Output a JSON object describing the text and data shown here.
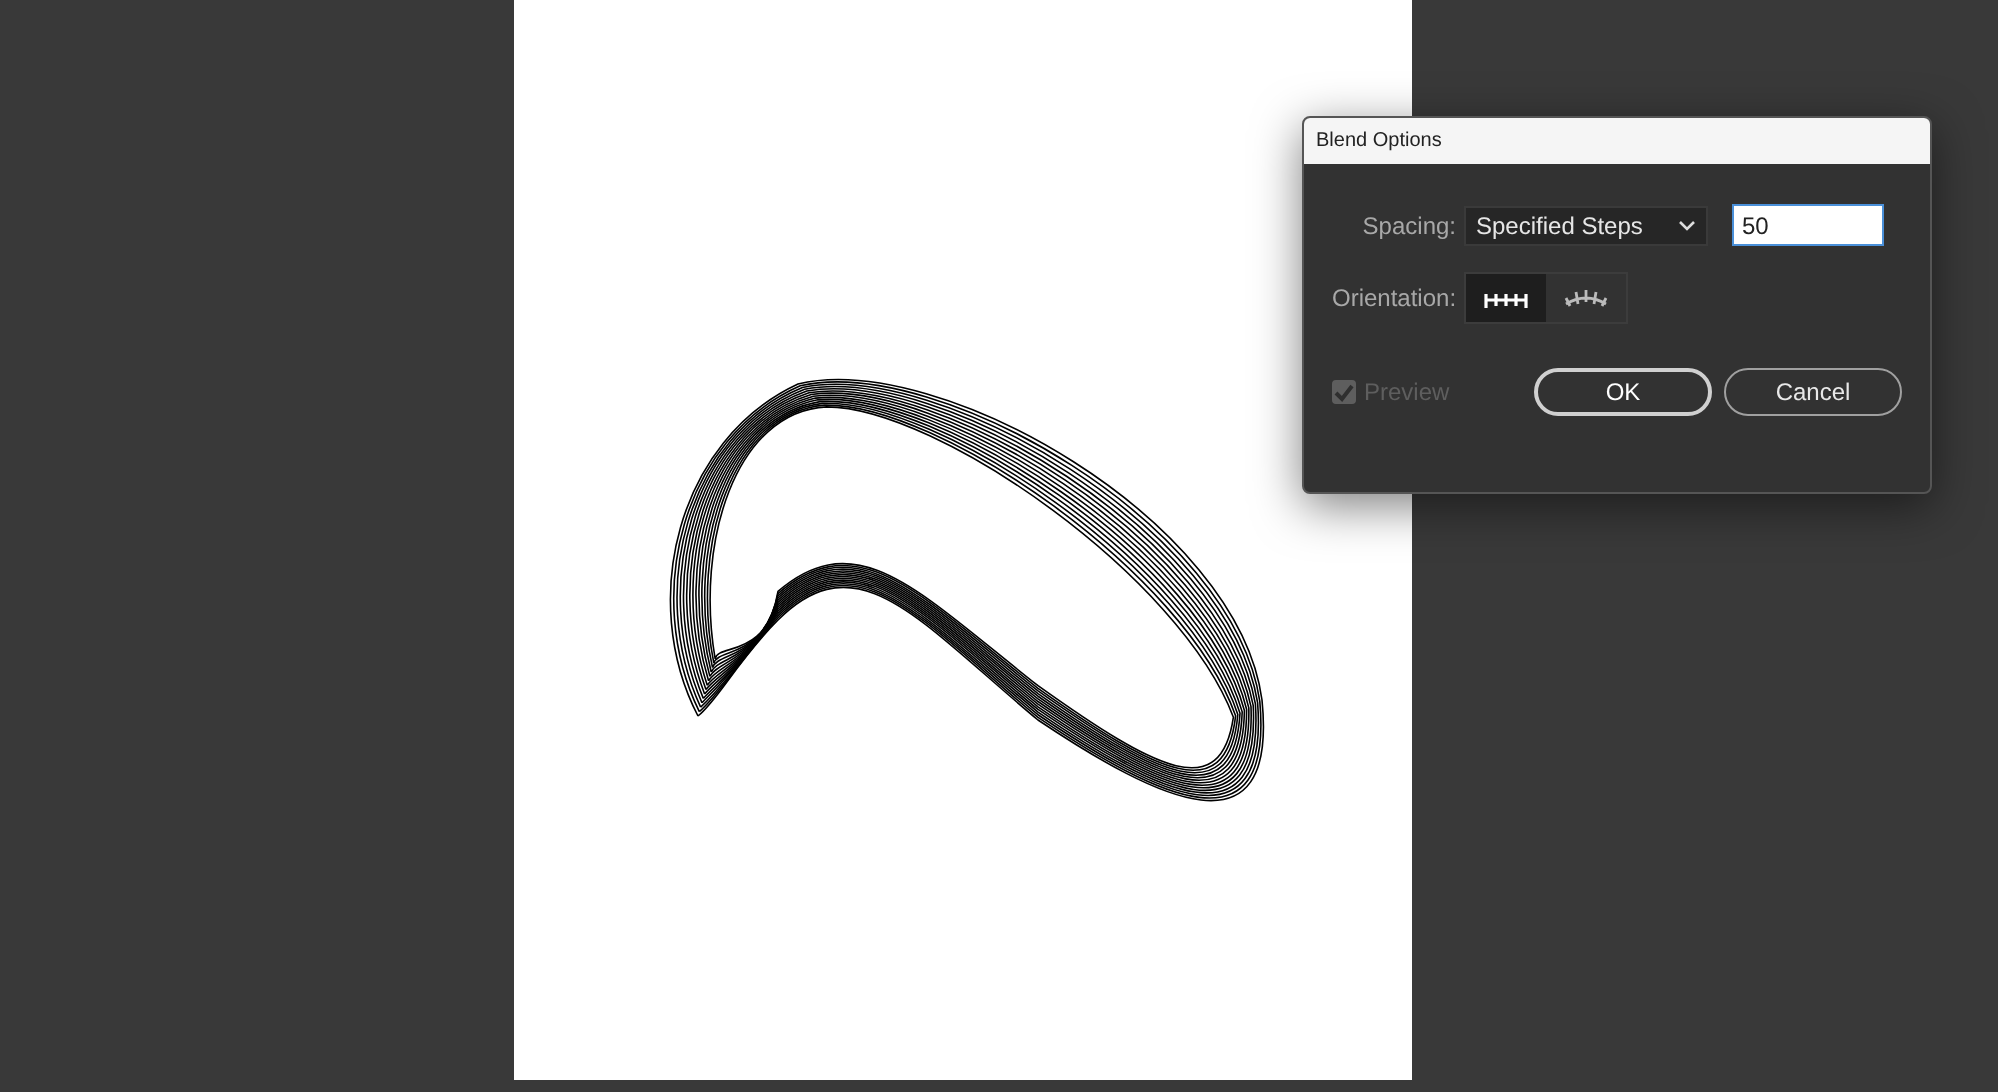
{
  "dialog": {
    "title": "Blend Options",
    "spacing": {
      "label": "Spacing:",
      "value": "Specified Steps",
      "steps": "50"
    },
    "orientation": {
      "label": "Orientation:",
      "options": [
        {
          "kind": "page",
          "selected": true
        },
        {
          "kind": "path",
          "selected": false
        }
      ]
    },
    "preview": {
      "label": "Preview",
      "checked": true,
      "disabled": true
    },
    "buttons": [
      {
        "label": "OK",
        "default": true
      },
      {
        "label": "Cancel",
        "default": false
      }
    ]
  }
}
